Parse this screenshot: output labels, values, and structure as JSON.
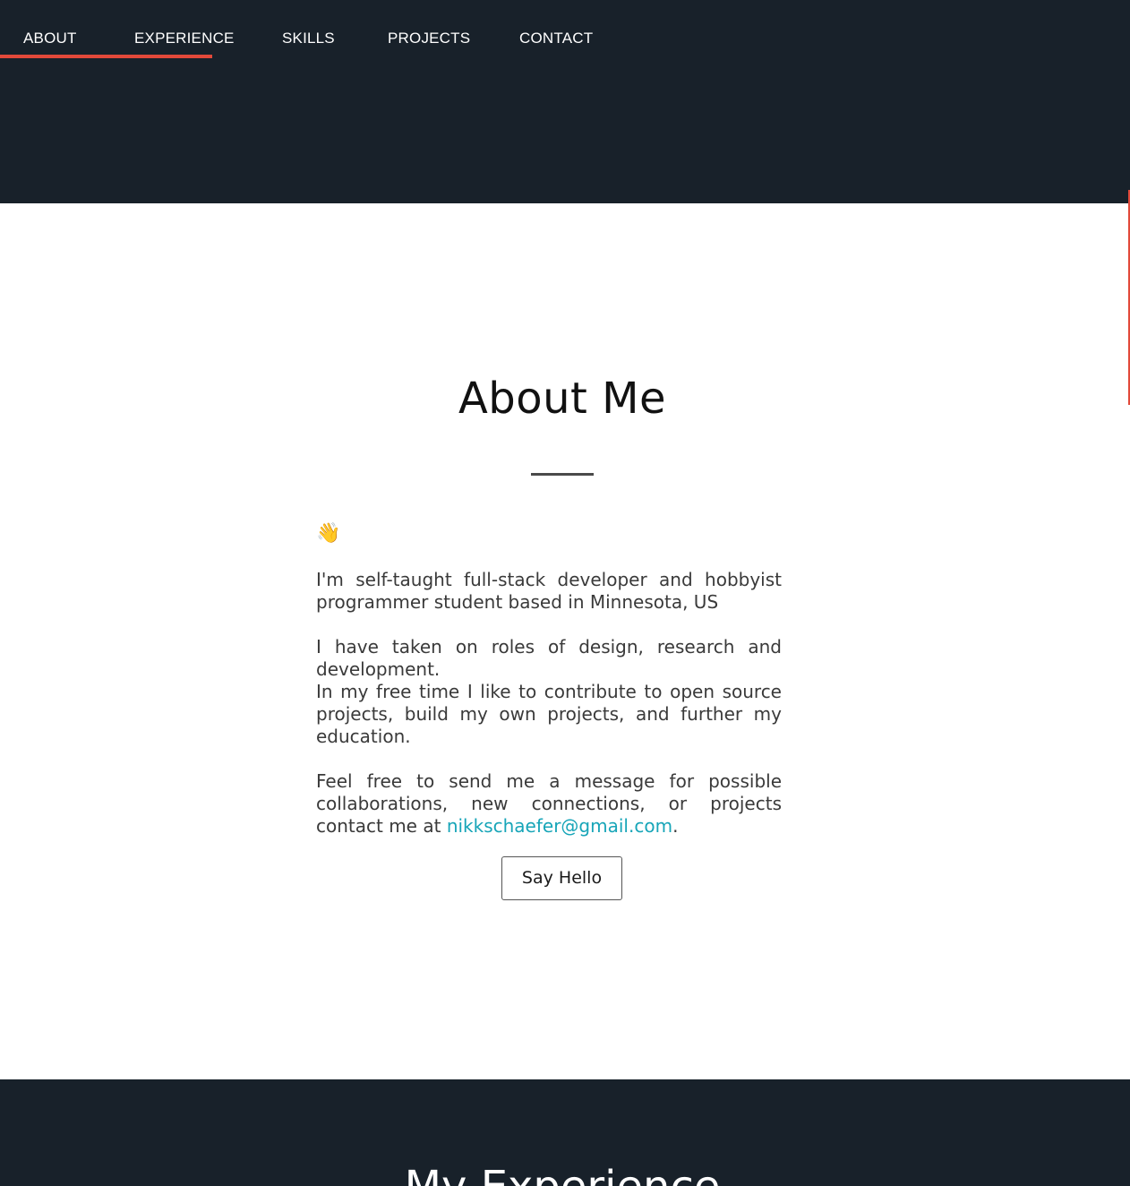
{
  "nav": {
    "items": [
      {
        "label": "ABOUT"
      },
      {
        "label": "EXPERIENCE"
      },
      {
        "label": "SKILLS"
      },
      {
        "label": "PROJECTS"
      },
      {
        "label": "CONTACT"
      }
    ],
    "active_indicator_color": "#e2493a"
  },
  "about": {
    "title": "About Me",
    "wave_icon": "👋",
    "paragraph1": "I'm self-taught full-stack developer and hobbyist programmer student based in Minnesota, US",
    "paragraph2a": "I have taken on roles of design, research and development.",
    "paragraph2b": "In my free time I like to contribute to open source projects, build my own projects, and further my education.",
    "paragraph3_prefix": "Feel free to send me a message for possible collaborations, new connections, or projects contact me at ",
    "email": "nikkschaefer@gmail.com",
    "paragraph3_suffix": ".",
    "button_label": "Say Hello"
  },
  "experience": {
    "title": "My Experience"
  },
  "colors": {
    "dark_bg": "#18212a",
    "accent": "#e2493a",
    "link": "#17a5b8"
  }
}
